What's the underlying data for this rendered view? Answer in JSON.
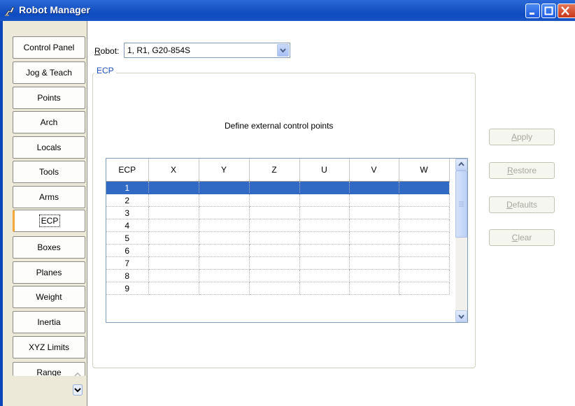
{
  "window": {
    "title": "Robot Manager"
  },
  "sidebar": {
    "tabs": [
      {
        "label": "Control Panel"
      },
      {
        "label": "Jog & Teach"
      },
      {
        "label": "Points"
      },
      {
        "label": "Arch"
      },
      {
        "label": "Locals"
      },
      {
        "label": "Tools"
      },
      {
        "label": "Arms"
      },
      {
        "label": "ECP",
        "active": true
      },
      {
        "label": "Boxes"
      },
      {
        "label": "Planes"
      },
      {
        "label": "Weight"
      },
      {
        "label": "Inertia"
      },
      {
        "label": "XYZ Limits"
      },
      {
        "label": "Range"
      }
    ]
  },
  "robot": {
    "label_prefix": "R",
    "label_rest": "obot:",
    "selected": "1, R1, G20-854S"
  },
  "ecp_group": {
    "title": "ECP",
    "instructions": "Define external control points"
  },
  "grid": {
    "columns": [
      "ECP",
      "X",
      "Y",
      "Z",
      "U",
      "V",
      "W"
    ],
    "rows": [
      "1",
      "2",
      "3",
      "4",
      "5",
      "6",
      "7",
      "8",
      "9"
    ],
    "selected_row": "1"
  },
  "buttons": {
    "apply": {
      "mnemonic": "A",
      "rest": "pply"
    },
    "restore": {
      "mnemonic": "R",
      "rest": "estore"
    },
    "defaults": {
      "mnemonic": "D",
      "rest": "efaults"
    },
    "clear": {
      "mnemonic": "C",
      "rest": "lear"
    }
  },
  "colors": {
    "selection": "#316ac5",
    "titlebar": "#0e4bc0",
    "group_title": "#1a4fbf"
  }
}
